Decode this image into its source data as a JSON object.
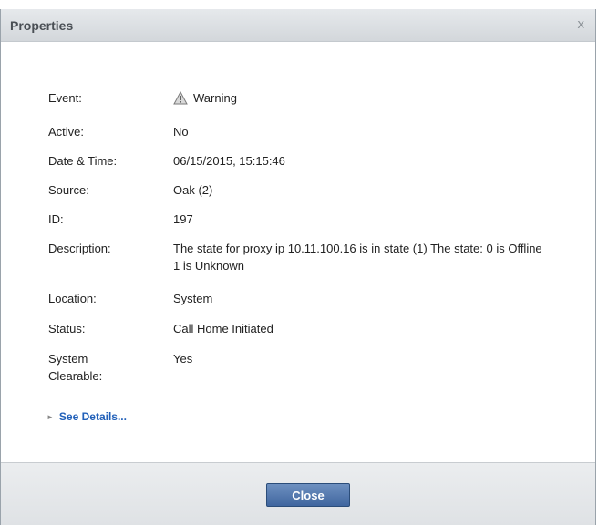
{
  "dialog": {
    "title": "Properties",
    "close_glyph": "x"
  },
  "properties": [
    {
      "label": "Event:",
      "value": "Warning",
      "icon": "warning-icon"
    },
    {
      "label": "Active:",
      "value": "No"
    },
    {
      "label": "Date & Time:",
      "value": "06/15/2015, 15:15:46"
    },
    {
      "label": "Source:",
      "value": "Oak (2)"
    },
    {
      "label": "ID:",
      "value": "197"
    },
    {
      "label": "Description:",
      "value": "The state for proxy ip 10.11.100.16 is in state (1) The state: 0 is Offline 1 is Unknown"
    },
    {
      "label": "Location:",
      "value": "System"
    },
    {
      "label": "Status:",
      "value": "Call Home Initiated"
    },
    {
      "label": "System Clearable:",
      "value": "Yes"
    }
  ],
  "see_details_label": "See Details...",
  "footer": {
    "close_label": "Close"
  },
  "colors": {
    "link": "#2160b9",
    "button": "#4a6fa5",
    "warning": "#9a9a9a"
  }
}
